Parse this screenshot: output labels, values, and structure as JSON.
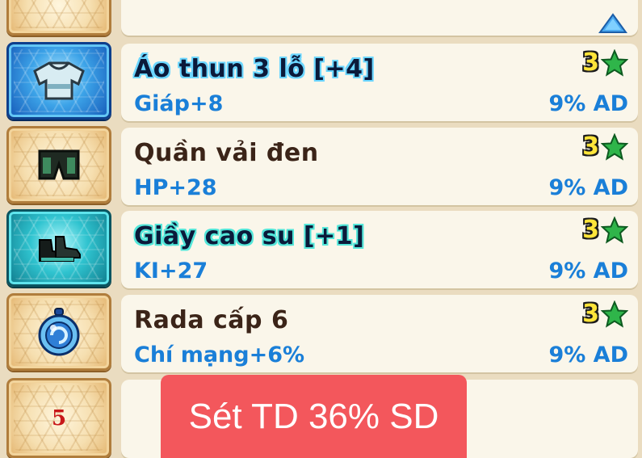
{
  "list": {
    "scroll_up_icon": "triangle-up-icon",
    "items": [
      {
        "name": "Áo thun 3 lỗ [+4]",
        "stat": "Giáp+8",
        "percent": "9% AD",
        "star_count": "3",
        "icon": "shirt-icon",
        "slot_color": "blue"
      },
      {
        "name": "Quần vải đen",
        "stat": "HP+28",
        "percent": "9% AD",
        "star_count": "3",
        "icon": "pants-icon",
        "slot_color": "tan"
      },
      {
        "name": "Giầy cao su [+1]",
        "stat": "KI+27",
        "percent": "9% AD",
        "star_count": "3",
        "icon": "shoes-icon",
        "slot_color": "teal"
      },
      {
        "name": "Rada cấp 6",
        "stat": "Chí mạng+6%",
        "percent": "9% AD",
        "star_count": "3",
        "icon": "radar-icon",
        "slot_color": "tan"
      }
    ],
    "last_slot_number": "5"
  },
  "overlay": {
    "badge_text": "Sét TD 36% SD",
    "badge_color": "#f3575c"
  },
  "colors": {
    "stat_text": "#1a7fd8",
    "name_text": "#3b2418",
    "star_green": "#2fb54a",
    "star_count": "#ffe53a"
  }
}
